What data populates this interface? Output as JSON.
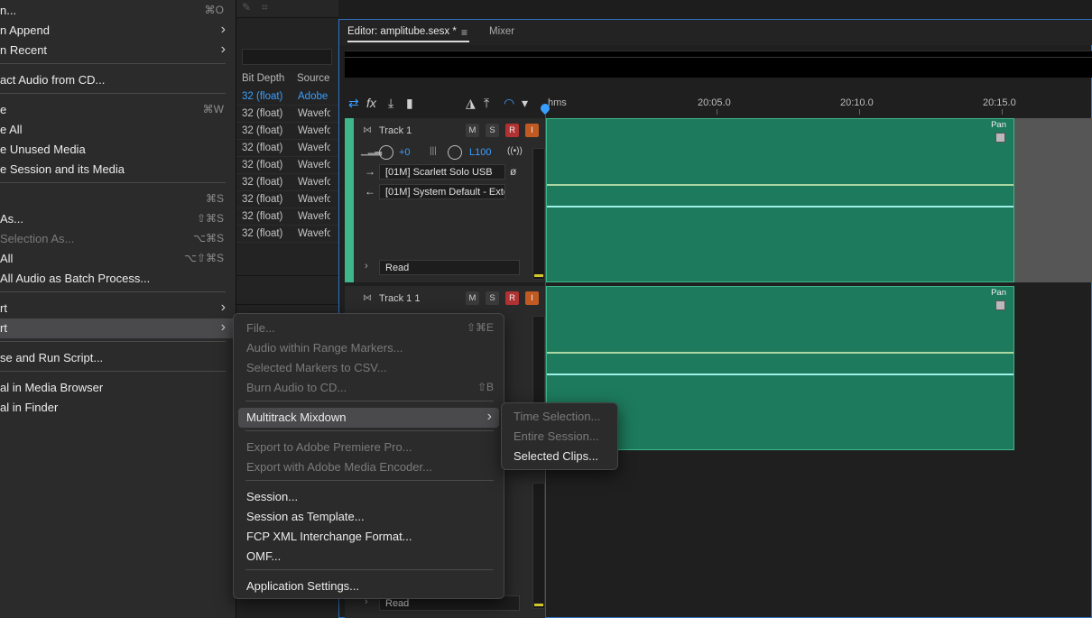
{
  "file_menu": {
    "items": [
      {
        "label": "n...",
        "shortcut": "⌘O",
        "disabled": false,
        "submenu": false
      },
      {
        "label": "n Append",
        "shortcut": "",
        "disabled": false,
        "submenu": true
      },
      {
        "label": "n Recent",
        "shortcut": "",
        "disabled": false,
        "submenu": true
      },
      {
        "label": "act Audio from CD...",
        "shortcut": "",
        "disabled": false,
        "submenu": false
      },
      {
        "label": "e",
        "shortcut": "⌘W",
        "disabled": false,
        "submenu": false
      },
      {
        "label": "e All",
        "shortcut": "",
        "disabled": false,
        "submenu": false
      },
      {
        "label": "e Unused Media",
        "shortcut": "",
        "disabled": false,
        "submenu": false
      },
      {
        "label": "e Session and its Media",
        "shortcut": "",
        "disabled": false,
        "submenu": false
      },
      {
        "label": "",
        "shortcut": "⌘S",
        "disabled": false,
        "submenu": false
      },
      {
        "label": " As...",
        "shortcut": "⇧⌘S",
        "disabled": false,
        "submenu": false
      },
      {
        "label": " Selection As...",
        "shortcut": "⌥⌘S",
        "disabled": true,
        "submenu": false
      },
      {
        "label": " All",
        "shortcut": "⌥⇧⌘S",
        "disabled": false,
        "submenu": false
      },
      {
        "label": " All Audio as Batch Process...",
        "shortcut": "",
        "disabled": false,
        "submenu": false
      },
      {
        "label": "rt",
        "shortcut": "",
        "disabled": false,
        "submenu": true
      },
      {
        "label": "rt",
        "shortcut": "",
        "disabled": false,
        "submenu": true
      },
      {
        "label": "se and Run Script...",
        "shortcut": "",
        "disabled": false,
        "submenu": false
      },
      {
        "label": "al in Media Browser",
        "shortcut": "",
        "disabled": false,
        "submenu": false
      },
      {
        "label": "al in Finder",
        "shortcut": "",
        "disabled": false,
        "submenu": false
      }
    ]
  },
  "export_menu": {
    "items": [
      {
        "label": "File...",
        "shortcut": "⇧⌘E",
        "disabled": true
      },
      {
        "label": "Audio within Range Markers...",
        "shortcut": "",
        "disabled": true
      },
      {
        "label": "Selected Markers to CSV...",
        "shortcut": "",
        "disabled": true
      },
      {
        "label": "Burn Audio to CD...",
        "shortcut": "⇧B",
        "disabled": true
      },
      {
        "label": "Multitrack Mixdown",
        "shortcut": "",
        "disabled": false
      },
      {
        "label": "Export to Adobe Premiere Pro...",
        "shortcut": "",
        "disabled": true
      },
      {
        "label": "Export with Adobe Media Encoder...",
        "shortcut": "",
        "disabled": true
      },
      {
        "label": "Session...",
        "shortcut": "",
        "disabled": false
      },
      {
        "label": "Session as Template...",
        "shortcut": "",
        "disabled": false
      },
      {
        "label": "FCP XML Interchange Format...",
        "shortcut": "",
        "disabled": false
      },
      {
        "label": "OMF...",
        "shortcut": "",
        "disabled": false
      },
      {
        "label": "Application Settings...",
        "shortcut": "",
        "disabled": false
      }
    ]
  },
  "mixdown_menu": {
    "items": [
      {
        "label": "Time Selection...",
        "disabled": true
      },
      {
        "label": "Entire Session...",
        "disabled": true
      },
      {
        "label": "Selected Clips...",
        "disabled": false
      }
    ]
  },
  "files_panel": {
    "headers": {
      "bit_depth": "Bit Depth",
      "source": "Source"
    },
    "rows": [
      {
        "bit_depth": "32 (float)",
        "source": "Adobe",
        "selected": true
      },
      {
        "bit_depth": "32 (float)",
        "source": "Wavefo",
        "selected": false
      },
      {
        "bit_depth": "32 (float)",
        "source": "Wavefo",
        "selected": false
      },
      {
        "bit_depth": "32 (float)",
        "source": "Wavefo",
        "selected": false
      },
      {
        "bit_depth": "32 (float)",
        "source": "Wavefo",
        "selected": false
      },
      {
        "bit_depth": "32 (float)",
        "source": "Wavefo",
        "selected": false
      },
      {
        "bit_depth": "32 (float)",
        "source": "Wavefo",
        "selected": false
      },
      {
        "bit_depth": "32 (float)",
        "source": "Wavefo",
        "selected": false
      },
      {
        "bit_depth": "32 (float)",
        "source": "Wavefo",
        "selected": false
      }
    ]
  },
  "editor": {
    "tab_editor": "Editor: amplitube.sesx *",
    "tab_mixer": "Mixer",
    "ruler": {
      "start": "hms",
      "t1": "20:05.0",
      "t2": "20:10.0",
      "t3": "20:15.0"
    },
    "tracks": [
      {
        "name": "Track 1",
        "volume": "+0",
        "pan": "L100",
        "input": "[01M] Scarlett Solo USB",
        "output": "[01M] System Default - Exte",
        "automation": "Read",
        "clip_pan_label": "Pan"
      },
      {
        "name": "Track 1 1",
        "automation": "Read",
        "clip_pan_label": "Pan"
      }
    ],
    "track_buttons": {
      "mute": "M",
      "solo": "S",
      "record": "R",
      "input": "I"
    }
  },
  "colors": {
    "accent_blue": "#3a9eff",
    "clip_green": "#1d7a5c",
    "track_green": "#3fb68a",
    "record_red": "#b03232",
    "input_orange": "#c05a22"
  }
}
